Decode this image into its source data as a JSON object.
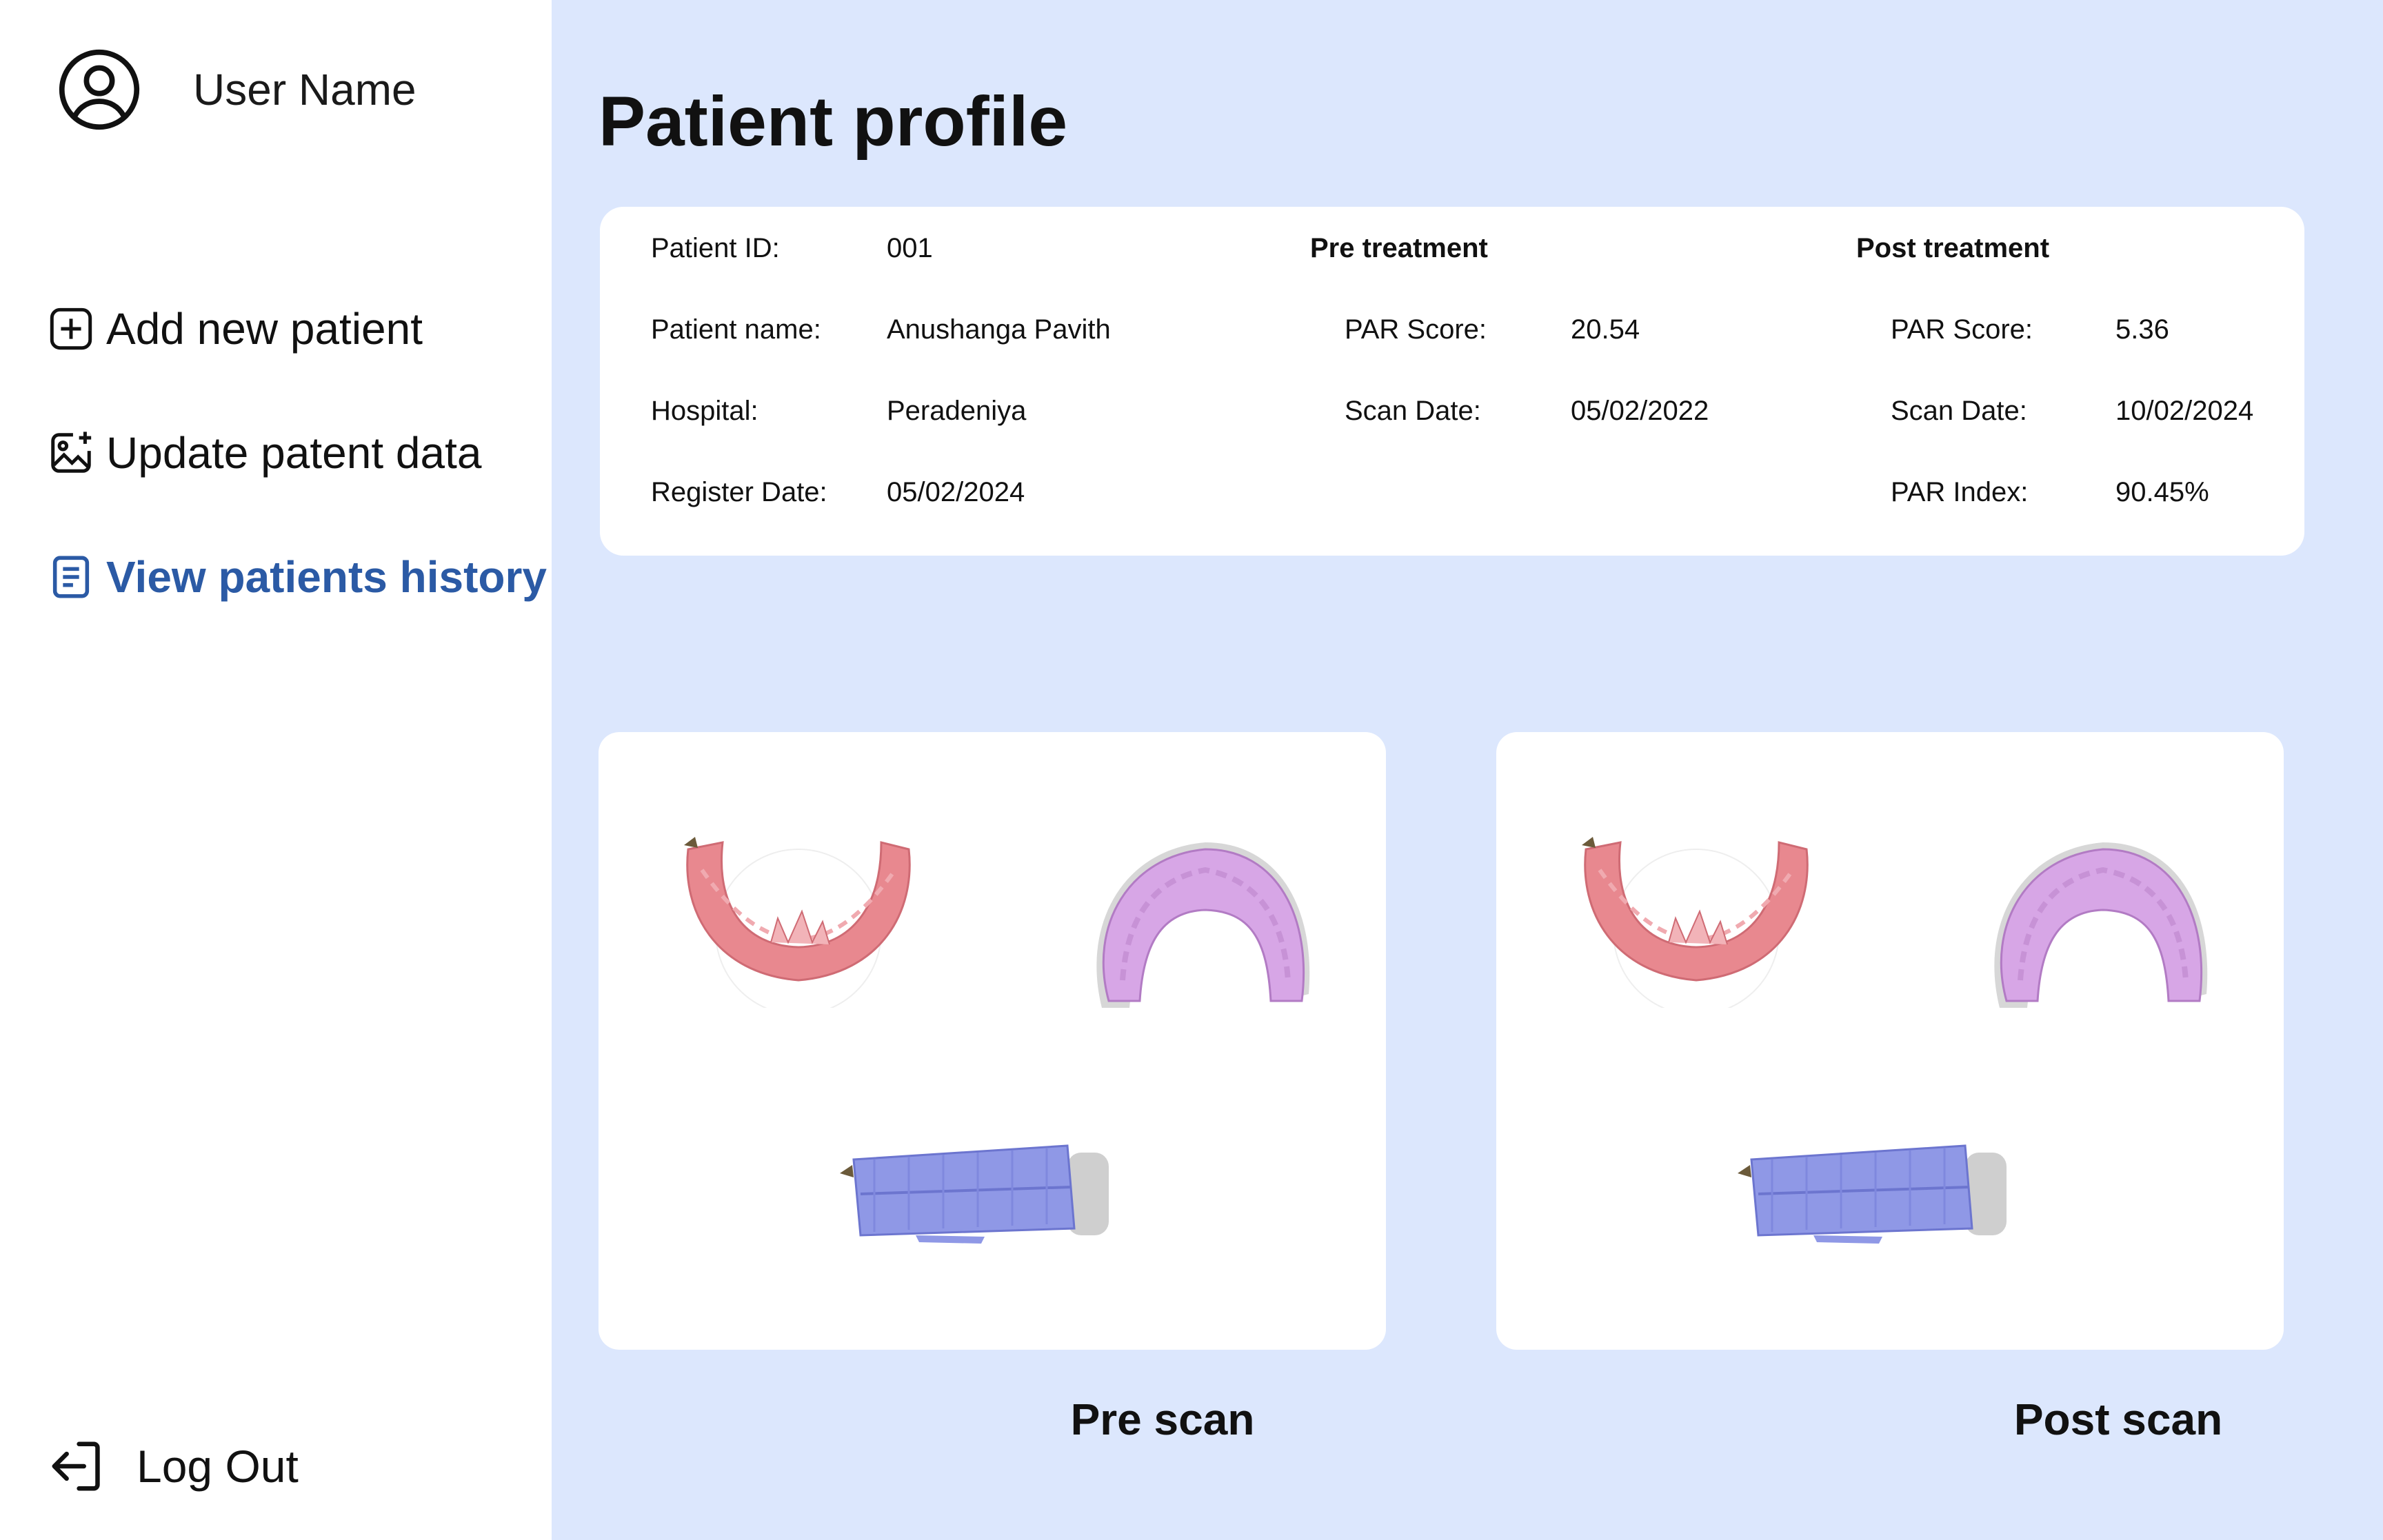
{
  "sidebar": {
    "user_name": "User Name",
    "nav": {
      "add": "Add new patient",
      "update": "Update patent data",
      "history": "View patients history"
    },
    "logout": "Log Out",
    "active_color": "#2b5aa5"
  },
  "main": {
    "title": "Patient profile",
    "patient": {
      "id_label": "Patient ID:",
      "id": "001",
      "name_label": "Patient name:",
      "name": "Anushanga Pavith",
      "hospital_label": "Hospital:",
      "hospital": "Peradeniya",
      "register_label": "Register Date:",
      "register_date": "05/02/2024"
    },
    "pre": {
      "heading": "Pre treatment",
      "par_label": "PAR Score:",
      "par": "20.54",
      "date_label": "Scan Date:",
      "date": "05/02/2022"
    },
    "post": {
      "heading": "Post treatment",
      "par_label": "PAR Score:",
      "par": "5.36",
      "date_label": "Scan Date:",
      "date": "10/02/2024",
      "index_label": "PAR Index:",
      "index": "90.45%"
    },
    "scans": {
      "pre_label": "Pre scan",
      "post_label": "Post scan"
    }
  },
  "colors": {
    "background": "#dce7fd",
    "lower_arch": "#e8888f",
    "upper_arch": "#d7a6e6",
    "occlusion": "#8f98e6"
  }
}
